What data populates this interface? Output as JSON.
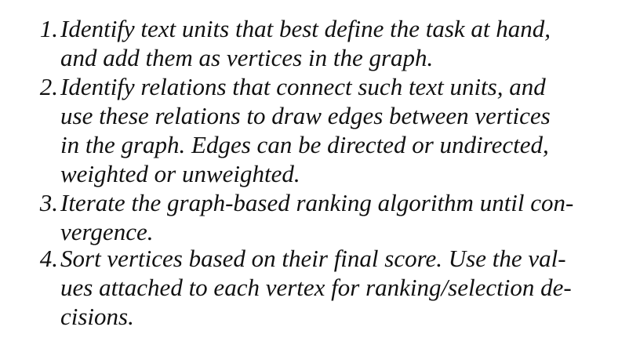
{
  "steps": [
    {
      "number": "1.",
      "lines": [
        "Identify text units that best define the task at hand,",
        "and add them as vertices in the graph."
      ]
    },
    {
      "number": "2.",
      "lines": [
        "Identify relations that connect such text units, and",
        "use these relations to draw edges between vertices",
        "in the graph.  Edges can be directed or undirected,",
        "weighted or unweighted."
      ]
    },
    {
      "number": "3.",
      "lines": [
        "Iterate the graph-based ranking algorithm until con-",
        "vergence."
      ]
    },
    {
      "number": "4.",
      "lines": [
        "Sort vertices based on their final score. Use the val-",
        "ues attached to each vertex for ranking/selection de-",
        "cisions."
      ]
    }
  ]
}
